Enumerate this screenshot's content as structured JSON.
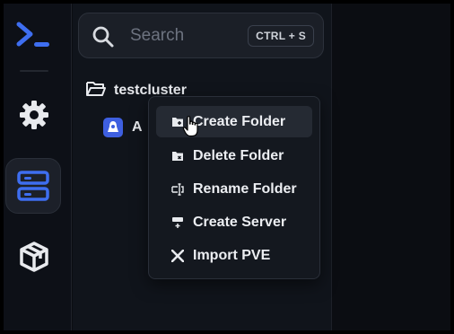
{
  "colors": {
    "accent": "#3e6ef0",
    "server_badge": "#3e5fe0",
    "background": "#0b0d12",
    "panel": "#10141b",
    "menu": "#14181f",
    "text": "#eceef2",
    "muted": "#6d7380"
  },
  "rail": {
    "items": [
      {
        "name": "terminal-logo",
        "icon": "terminal-icon"
      },
      {
        "name": "settings",
        "icon": "gear-icon"
      },
      {
        "name": "servers",
        "icon": "server-stack-icon",
        "active": true
      },
      {
        "name": "packages",
        "icon": "cube-icon"
      }
    ]
  },
  "search": {
    "placeholder": "Search",
    "shortcut": "CTRL + S"
  },
  "tree": {
    "folder_name": "testcluster",
    "server_label": "A"
  },
  "context_menu": {
    "items": [
      {
        "label": "Create Folder",
        "icon": "folder-plus-icon",
        "hovered": true
      },
      {
        "label": "Delete Folder",
        "icon": "folder-x-icon"
      },
      {
        "label": "Rename Folder",
        "icon": "rename-icon"
      },
      {
        "label": "Create Server",
        "icon": "server-plus-icon"
      },
      {
        "label": "Import PVE",
        "icon": "proxmox-icon"
      }
    ]
  }
}
